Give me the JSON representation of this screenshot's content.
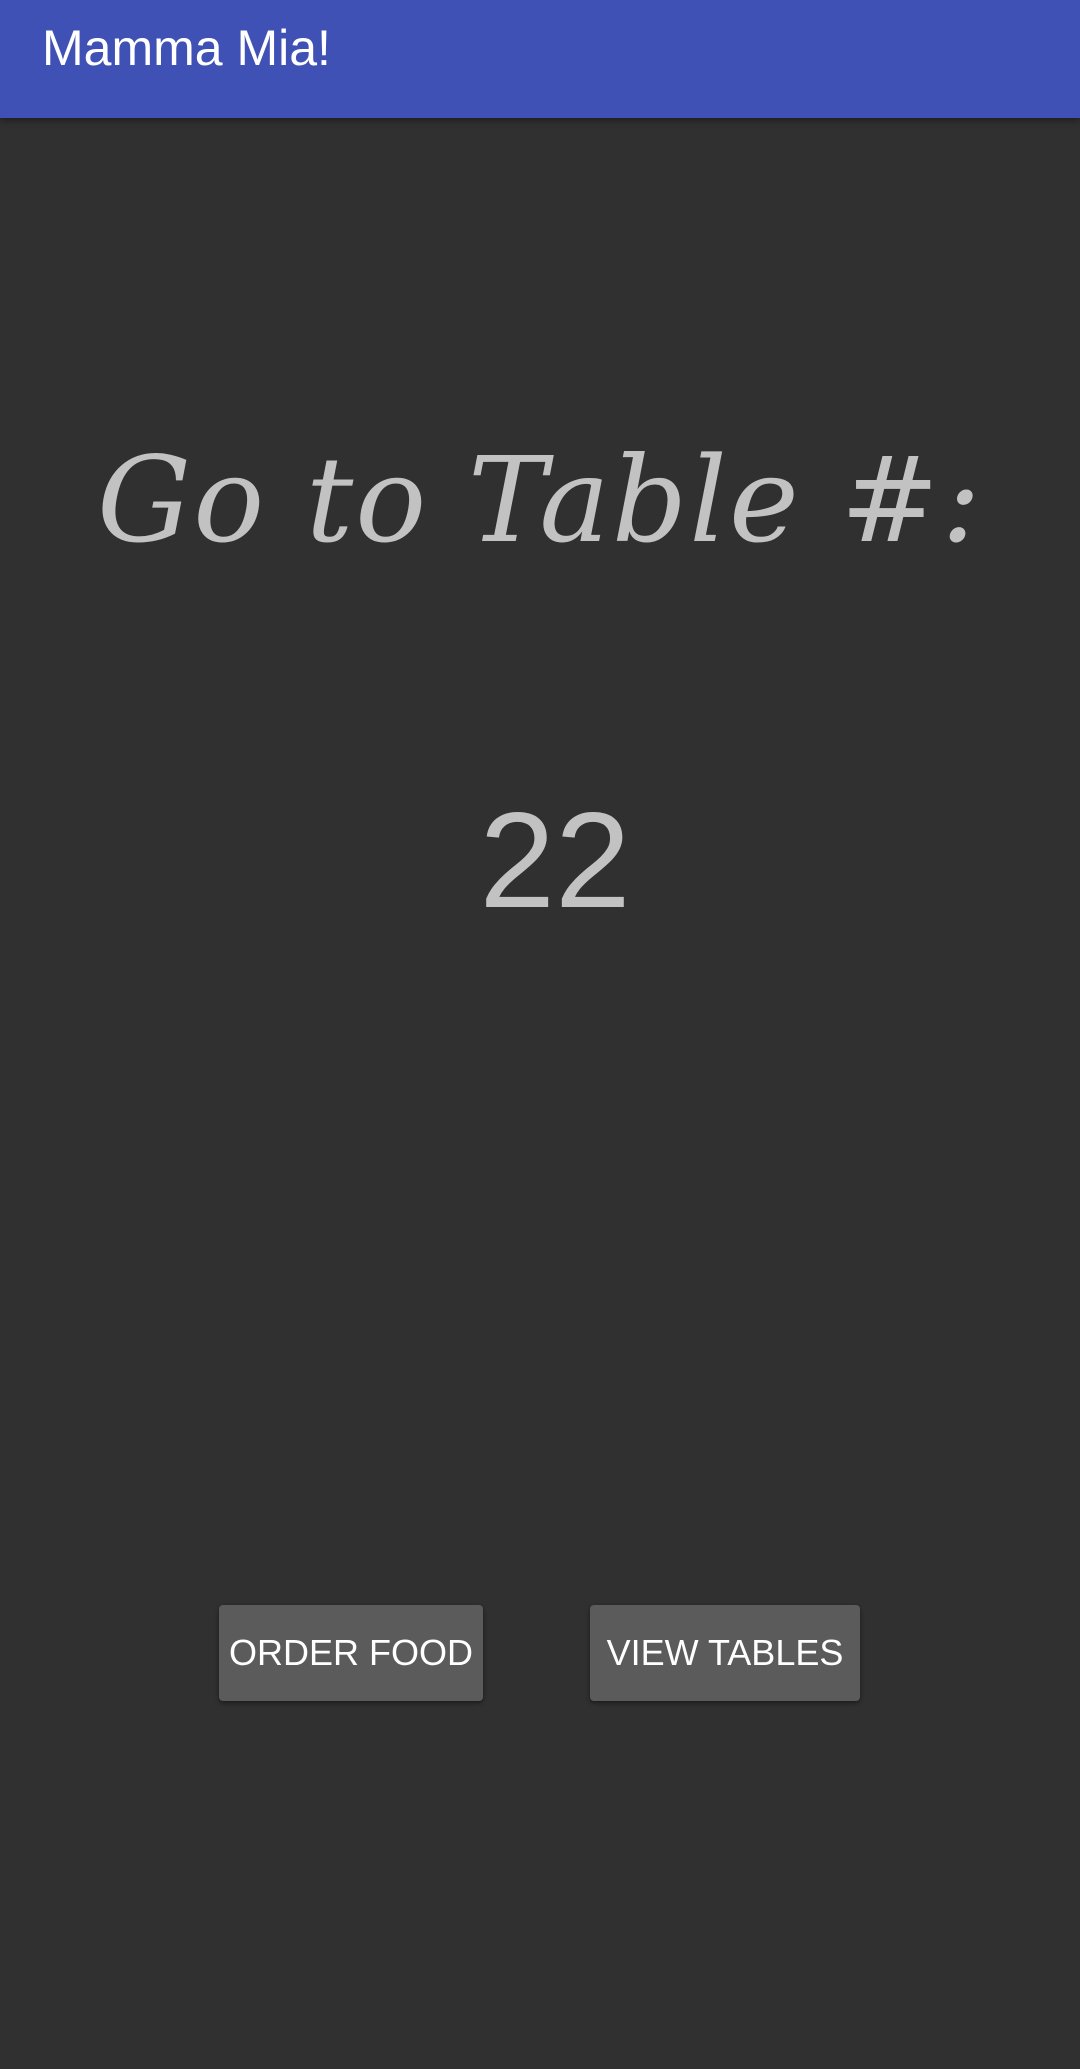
{
  "app_bar": {
    "title": "Mamma Mia!",
    "color": "#3f51b5"
  },
  "main": {
    "prompt": "Go to Table #:",
    "table_number": "22"
  },
  "actions": {
    "order_food_label": "ORDER FOOD",
    "view_tables_label": "VIEW TABLES"
  },
  "colors": {
    "background": "#303030",
    "button": "#5b5b5b",
    "text_muted": "#c2c2c2"
  }
}
